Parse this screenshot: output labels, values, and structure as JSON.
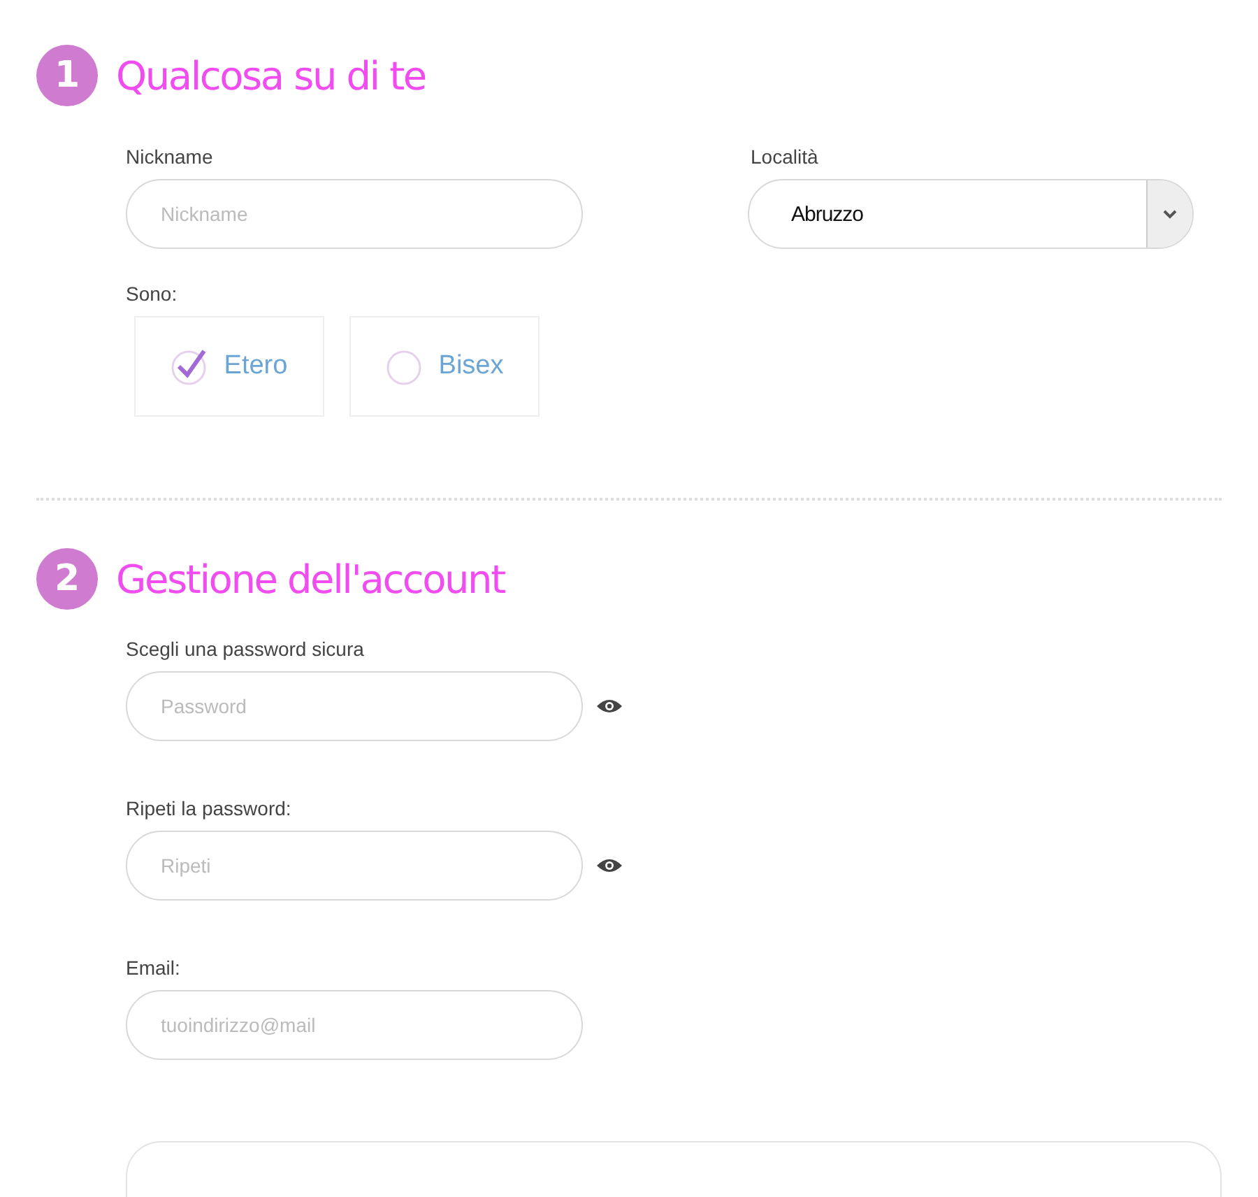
{
  "sections": [
    {
      "number": "1",
      "title": "Qualcosa su di te"
    },
    {
      "number": "2",
      "title": "Gestione dell'account"
    }
  ],
  "nickname": {
    "label": "Nickname",
    "placeholder": "Nickname"
  },
  "location": {
    "label": "Località",
    "value": "Abruzzo"
  },
  "orientation": {
    "label": "Sono:",
    "options": [
      {
        "label": "Etero",
        "selected": true
      },
      {
        "label": "Bisex",
        "selected": false
      }
    ]
  },
  "password": {
    "label": "Scegli una password sicura",
    "placeholder": "Password"
  },
  "repeat": {
    "label": "Ripeti la password:",
    "placeholder": "Ripeti"
  },
  "email": {
    "label": "Email:",
    "placeholder": "tuoindirizzo@mail"
  }
}
